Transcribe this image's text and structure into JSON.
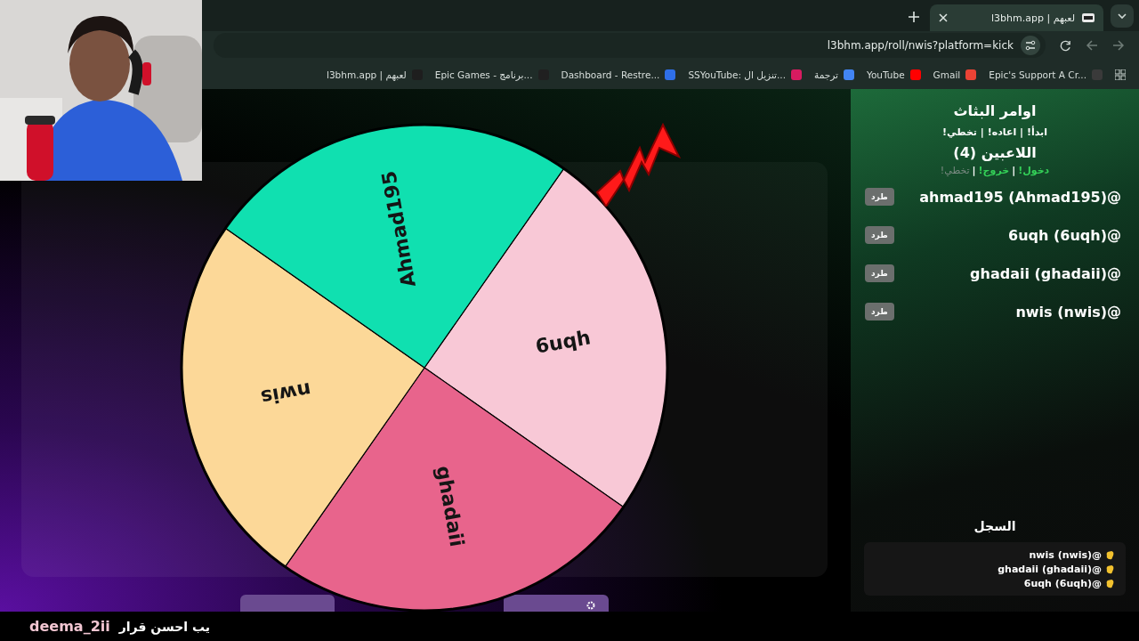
{
  "browser": {
    "tabs": [
      {
        "title": "l3bhm.app | لعبهم",
        "selected": true
      }
    ],
    "url": "l3bhm.app/roll/nwis?platform=kick",
    "bookmarks": [
      {
        "label": "Epic's Support A Cr...",
        "color": "#3a3a3a"
      },
      {
        "label": "Gmail",
        "color": "#ea4335"
      },
      {
        "label": "YouTube",
        "color": "#ff0000"
      },
      {
        "label": "ترجمة",
        "color": "#4285f4"
      },
      {
        "label": "SSYouTube: تنزيل ال...",
        "color": "#d81b60"
      },
      {
        "label": "Dashboard - Restre...",
        "color": "#2f6fe8"
      },
      {
        "label": "Epic Games - برنامج...",
        "color": "#202020"
      },
      {
        "label": "l3bhm.app | لعبهم",
        "color": "#1e1e1e"
      }
    ]
  },
  "wheel": {
    "segments": [
      {
        "label": "6uqh",
        "color": "#f8c8d6"
      },
      {
        "label": "ghadaii",
        "color": "#e8648c"
      },
      {
        "label": "nwis",
        "color": "#fcd898"
      },
      {
        "label": "Ahmad195",
        "color": "#10e0b0"
      }
    ]
  },
  "buttons": [
    {
      "kind": "spin"
    },
    {
      "kind": "reset"
    }
  ],
  "panel": {
    "title": "اوامر البثاث",
    "commands": "ابدأ! | اعاده! | تخطي!",
    "players_title": "اللاعبين (4)",
    "separator": "|",
    "player_commands": [
      {
        "label": "دخول!",
        "disabled": false
      },
      {
        "label": "خروج!",
        "disabled": false
      },
      {
        "label": "تخطي!",
        "disabled": true
      }
    ],
    "players": [
      {
        "name": "@ahmad195 (Ahmad195)",
        "action": "طرد"
      },
      {
        "name": "@6uqh (6uqh)",
        "action": "طرد"
      },
      {
        "name": "@ghadaii (ghadaii)",
        "action": "طرد"
      },
      {
        "name": "@nwis (nwis)",
        "action": "طرد"
      }
    ]
  },
  "log": {
    "title": "السجل",
    "entries": [
      "@nwis (nwis)",
      "@ghadaii (ghadaii)",
      "@6uqh (6uqh)"
    ]
  },
  "caption": {
    "user": "deema_2ii",
    "message": "يب احسن قرار"
  }
}
